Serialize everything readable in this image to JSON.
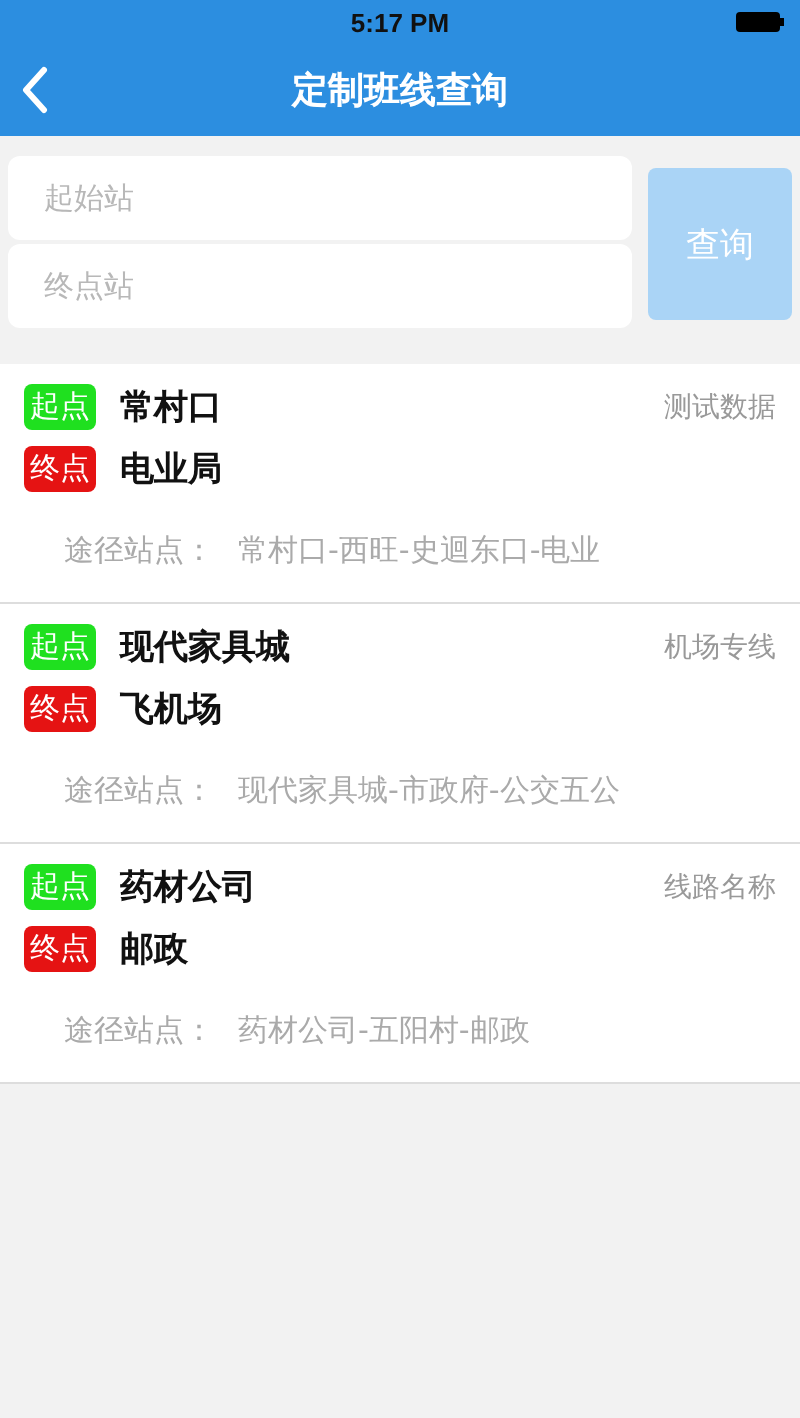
{
  "status_bar": {
    "time": "5:17 PM"
  },
  "nav": {
    "title": "定制班线查询"
  },
  "search": {
    "from": {
      "placeholder": "起始站"
    },
    "to": {
      "placeholder": "终点站"
    },
    "button": "查询",
    "disabled": true
  },
  "routes": [
    {
      "stops": [
        {
          "kind": "start",
          "badge": "起点",
          "name": "常村口"
        },
        {
          "kind": "end",
          "badge": "终点",
          "name": "电业局"
        }
      ],
      "tag": "测试数据",
      "via_label": "途径站点：",
      "via": "常村口-西旺-史迴东口-电业"
    },
    {
      "stops": [
        {
          "kind": "start",
          "badge": "起点",
          "name": "现代家具城"
        },
        {
          "kind": "end",
          "badge": "终点",
          "name": "飞机场"
        }
      ],
      "tag": "机场专线",
      "via_label": "途径站点：",
      "via": "现代家具城-市政府-公交五公"
    },
    {
      "stops": [
        {
          "kind": "start",
          "badge": "起点",
          "name": "药材公司"
        },
        {
          "kind": "end",
          "badge": "终点",
          "name": "邮政"
        }
      ],
      "tag": "线路名称",
      "via_label": "途径站点：",
      "via": "药材公司-五阳村-邮政"
    }
  ]
}
